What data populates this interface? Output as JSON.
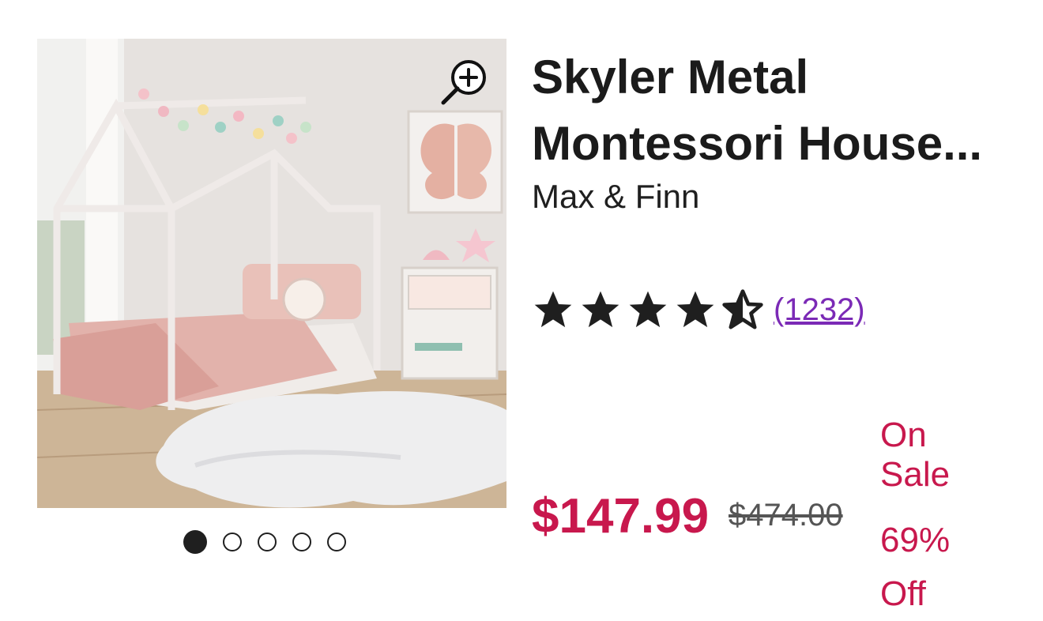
{
  "product": {
    "title": "Skyler Metal Montessori House...",
    "brand": "Max & Finn",
    "rating": 4.5,
    "review_count": "(1232)",
    "sale_price": "$147.99",
    "original_price": "$474.00",
    "sale_label": "On Sale",
    "discount_label": "69% Off"
  },
  "gallery": {
    "image_count": 5,
    "active_index": 0,
    "zoom_icon": "zoom-in-icon"
  },
  "colors": {
    "price": "#c8184d",
    "reviews_link": "#7b2ab6",
    "text": "#1f1f1f"
  }
}
